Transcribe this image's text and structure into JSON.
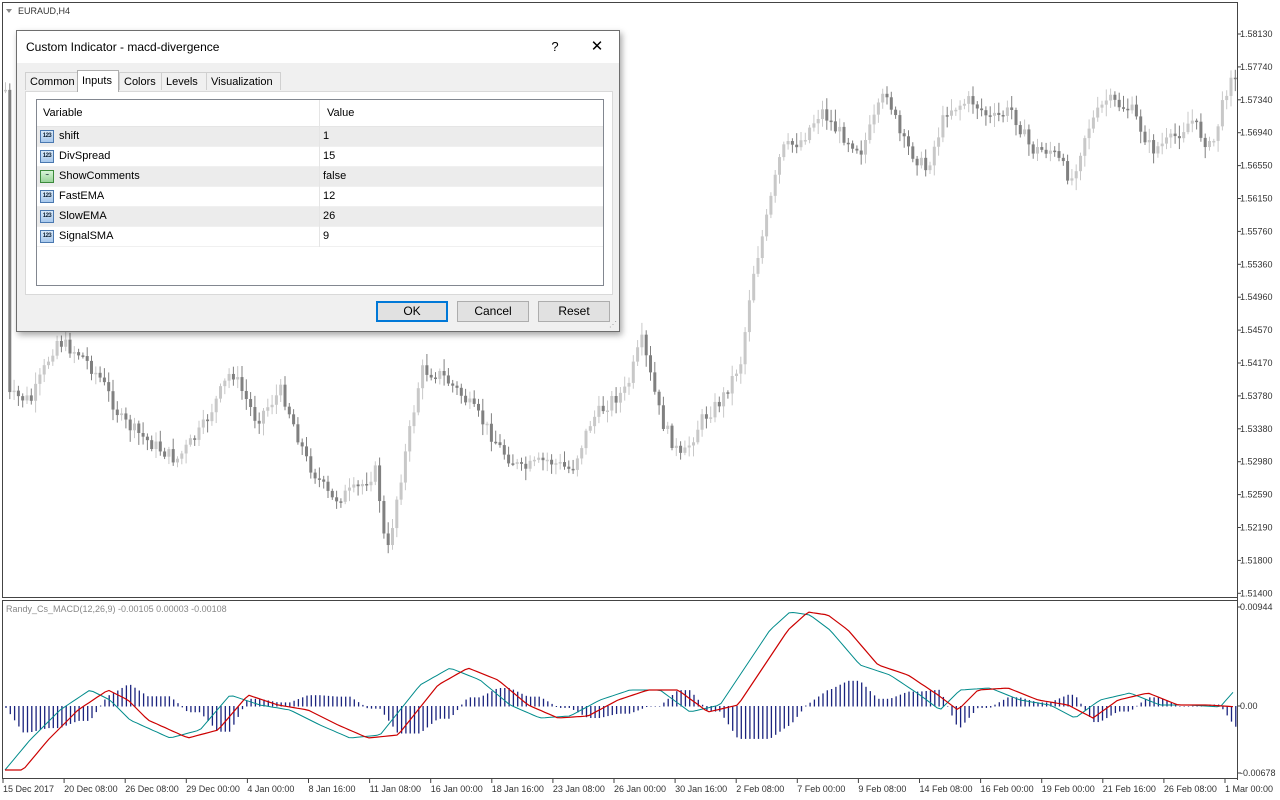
{
  "chart": {
    "symbol_label": "EURAUD,H4",
    "indicator_label": "Randy_Cs_MACD(12,26,9) -0.00105 0.00003 -0.00108",
    "price_ticks": [
      "1.58130",
      "1.57740",
      "1.57340",
      "1.56940",
      "1.56550",
      "1.56150",
      "1.55760",
      "1.55360",
      "1.54960",
      "1.54570",
      "1.54170",
      "1.53780",
      "1.53380",
      "1.52980",
      "1.52590",
      "1.52190",
      "1.51800",
      "1.51400"
    ],
    "indicator_ticks": [
      "0.00944",
      "0.00",
      "-0.00678"
    ],
    "date_ticks": [
      "15 Dec 2017",
      "20 Dec 08:00",
      "26 Dec 08:00",
      "29 Dec 00:00",
      "4 Jan 00:00",
      "8 Jan 16:00",
      "11 Jan 08:00",
      "16 Jan 00:00",
      "18 Jan 16:00",
      "23 Jan 08:00",
      "26 Jan 00:00",
      "30 Jan 16:00",
      "2 Feb 08:00",
      "7 Feb 00:00",
      "9 Feb 08:00",
      "14 Feb 08:00",
      "16 Feb 00:00",
      "19 Feb 00:00",
      "21 Feb 16:00",
      "26 Feb 08:00",
      "1 Mar 00:00"
    ],
    "colors": {
      "bull": "#c8c8c8",
      "bear": "#808080",
      "histogram": "#1a237e",
      "macd_line": "#008b8b",
      "signal_line": "#cc0000"
    }
  },
  "dialog": {
    "title": "Custom Indicator - macd-divergence",
    "help_symbol": "?",
    "close_symbol": "✕",
    "tabs": [
      "Common",
      "Inputs",
      "Colors",
      "Levels",
      "Visualization"
    ],
    "active_tab": "Inputs",
    "columns": {
      "variable": "Variable",
      "value": "Value"
    },
    "rows": [
      {
        "name": "shift",
        "value": "1",
        "icon": "integer-icon"
      },
      {
        "name": "DivSpread",
        "value": "15",
        "icon": "integer-icon"
      },
      {
        "name": "ShowComments",
        "value": "false",
        "icon": "boolean-icon"
      },
      {
        "name": "FastEMA",
        "value": "12",
        "icon": "integer-icon"
      },
      {
        "name": "SlowEMA",
        "value": "26",
        "icon": "integer-icon"
      },
      {
        "name": "SignalSMA",
        "value": "9",
        "icon": "integer-icon"
      }
    ],
    "icon_text": "123",
    "buttons": {
      "ok": "OK",
      "cancel": "Cancel",
      "reset": "Reset"
    }
  }
}
